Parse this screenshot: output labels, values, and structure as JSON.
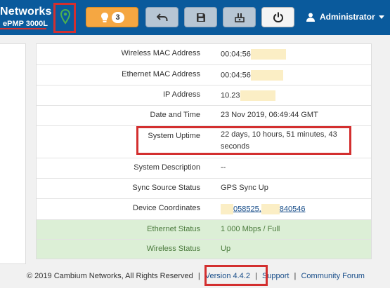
{
  "header": {
    "brand": "Networks",
    "model": "ePMP 3000L",
    "alerts_count": "3",
    "user_label": "Administrator"
  },
  "status_rows": [
    {
      "label": "Wireless MAC Address",
      "value": "00:04:56"
    },
    {
      "label": "Ethernet MAC Address",
      "value": "00:04:56"
    },
    {
      "label": "IP Address",
      "value": "10.23"
    },
    {
      "label": "Date and Time",
      "value": "23 Nov 2019, 06:49:44 GMT"
    },
    {
      "label": "System Uptime",
      "value": "22 days, 10 hours, 51 minutes, 43 seconds"
    },
    {
      "label": "System Description",
      "value": "--"
    },
    {
      "label": "Sync Source Status",
      "value": "GPS Sync Up"
    },
    {
      "label": "Device Coordinates",
      "value_part1": "058525,",
      "value_part2": "840546"
    },
    {
      "label": "Ethernet Status",
      "value": "1 000 Mbps / Full"
    },
    {
      "label": "Wireless Status",
      "value": "Up"
    }
  ],
  "footer": {
    "copyright": "© 2019 Cambium Networks, All Rights Reserved",
    "version": "Version 4.4.2",
    "support": "Support",
    "forum": "Community Forum",
    "separator": "|"
  },
  "colors": {
    "header_bg": "#0a5a9c",
    "annotation_red": "#d32f2f",
    "status_green_bg": "#dcefd6",
    "alert_orange": "#f5a742"
  },
  "icons": {
    "location": "map-pin-icon",
    "alerts": "lightbulb-icon",
    "undo": "undo-icon",
    "save": "floppy-disk-icon",
    "reboot_config": "tools-icon",
    "power": "power-icon",
    "user": "user-icon"
  }
}
